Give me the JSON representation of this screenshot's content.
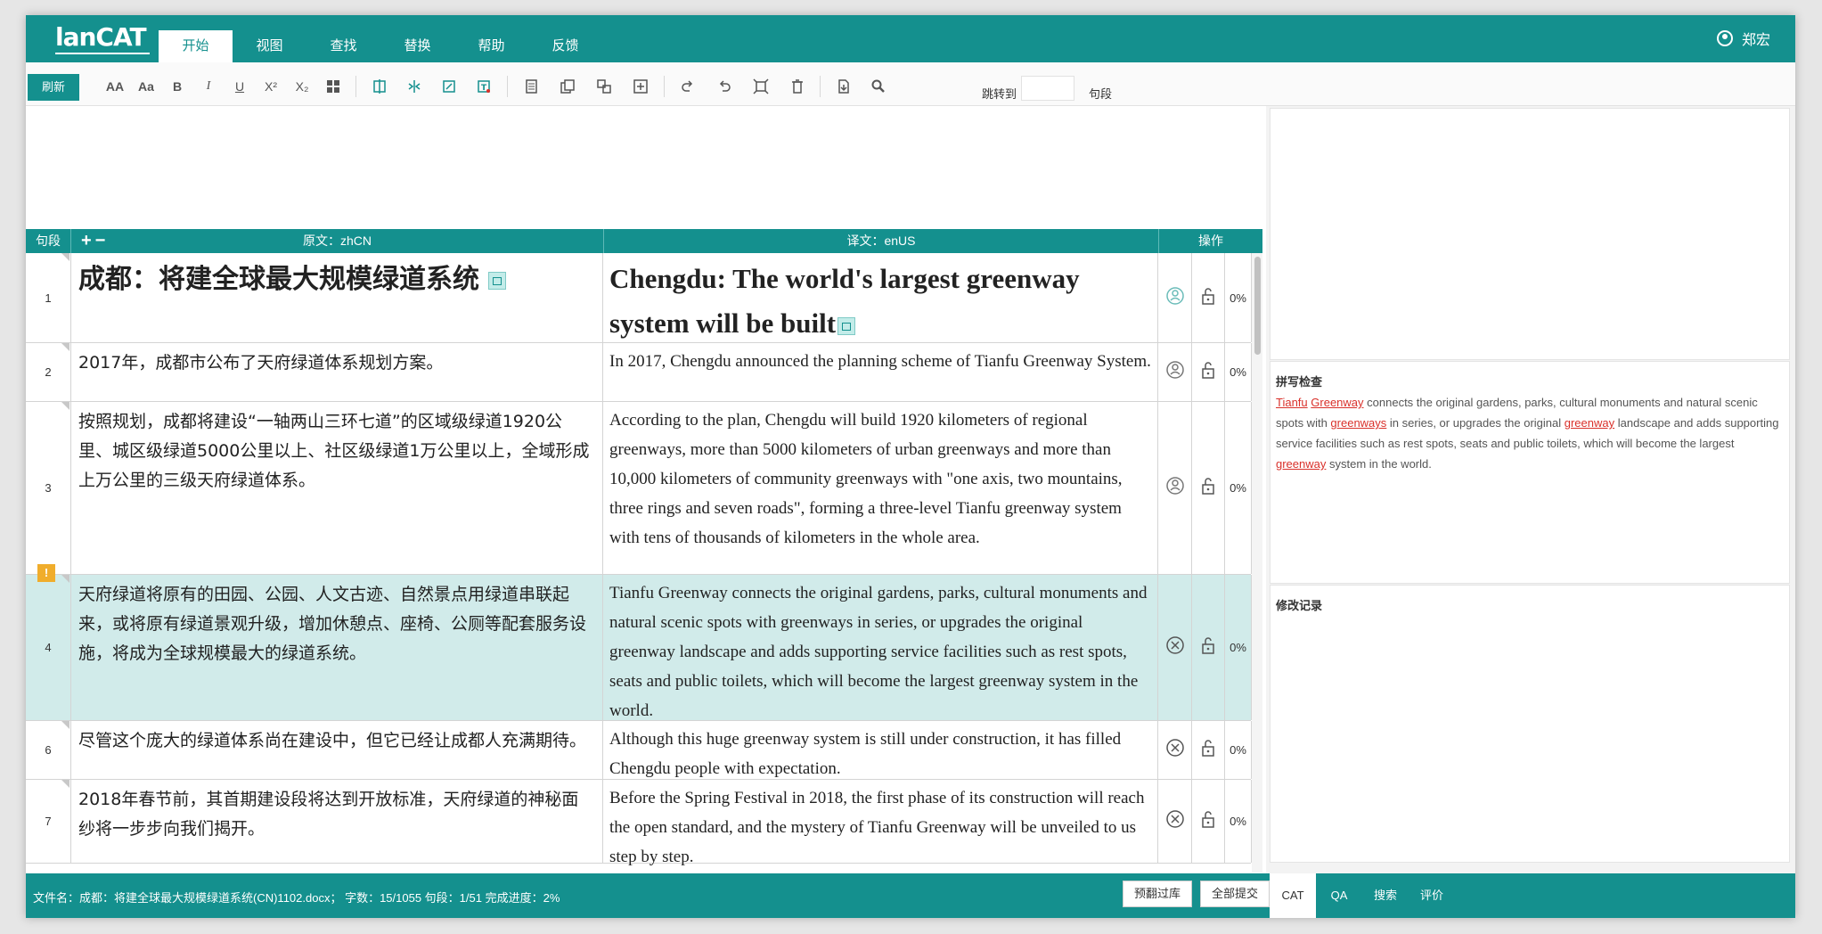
{
  "app": {
    "logo": "lanCAT",
    "tabs": [
      "开始",
      "视图",
      "查找",
      "替换",
      "帮助",
      "反馈"
    ],
    "active_tab": "开始",
    "user_name": "郑宏"
  },
  "toolbar": {
    "refresh_label": "刷新",
    "font_size_label": "AA",
    "case_label": "Aa",
    "bold_label": "B",
    "italic_label": "I",
    "underline_label": "U",
    "superscript_label": "X²",
    "subscript_label": "X₂",
    "jump_label": "跳转到",
    "jump_value": "",
    "jump_unit": "句段"
  },
  "grid": {
    "headers": {
      "segment": "句段",
      "plus_minus": "+−",
      "source": "原文：zhCN",
      "target": "译文：enUS",
      "actions": "操作"
    },
    "rows": [
      {
        "no": "1",
        "source": "成都：将建全球最大规模绿道系统",
        "target": "Chengdu: The world's largest greenway system will be built",
        "status": "0%",
        "confirm_icon": "pending-check-icon",
        "title_row": true
      },
      {
        "no": "2",
        "source": "2017年，成都市公布了天府绿道体系规划方案。",
        "target": "In 2017, Chengdu announced the planning scheme of Tianfu Greenway System.",
        "status": "0%",
        "confirm_icon": "pending-check-icon"
      },
      {
        "no": "3",
        "source": "按照规划，成都将建设“一轴两山三环七道”的区域级绿道1920公里、城区级绿道5000公里以上、社区级绿道1万公里以上，全域形成上万公里的三级天府绿道体系。",
        "target": "According to the plan, Chengdu will build 1920 kilometers of regional greenways, more than 5000 kilometers of urban greenways and more than 10,000 kilometers of community greenways with \"one axis, two mountains, three rings and seven roads\", forming a three-level Tianfu greenway system with tens of thousands of kilometers in the whole area.",
        "status": "0%",
        "confirm_icon": "pending-check-icon"
      },
      {
        "no": "4",
        "source": "天府绿道将原有的田园、公园、人文古迹、自然景点用绿道串联起来，或将原有绿道景观升级，增加休憩点、座椅、公厕等配套服务设施，将成为全球规模最大的绿道系统。",
        "target": "Tianfu Greenway connects the original gardens, parks, cultural monuments and natural scenic spots with greenways in series, or upgrades the original greenway landscape and adds supporting service facilities such as rest spots, seats and public toilets, which will become the largest greenway system in the world.",
        "status": "0%",
        "confirm_icon": "clear-icon",
        "warning": "!",
        "selected": true
      },
      {
        "no": "6",
        "source": "尽管这个庞大的绿道体系尚在建设中，但它已经让成都人充满期待。",
        "target": "Although this huge greenway system is still under construction, it has filled Chengdu people with expectation.",
        "status": "0%",
        "confirm_icon": "clear-icon"
      },
      {
        "no": "7",
        "source": "2018年春节前，其首期建设段将达到开放标准，天府绿道的神秘面纱将一步步向我们揭开。",
        "target": "Before the Spring Festival in 2018, the first phase of its construction will reach the open standard, and the mystery of Tianfu Greenway will be unveiled to us step by step.",
        "status": "0%",
        "confirm_icon": "clear-icon"
      }
    ]
  },
  "right_panel": {
    "spell_title": "拼写检查",
    "spell_parts": [
      {
        "t": "Tianfu",
        "err": true
      },
      {
        "t": " ",
        "err": false
      },
      {
        "t": "Greenway",
        "err": true
      },
      {
        "t": " connects the original gardens, parks, cultural monuments and natural scenic spots with ",
        "err": false
      },
      {
        "t": "greenways",
        "err": true
      },
      {
        "t": " in series, or upgrades the original ",
        "err": false
      },
      {
        "t": "greenway",
        "err": true
      },
      {
        "t": " landscape and adds supporting service facilities such as rest spots, seats and public toilets, which will become the largest ",
        "err": false
      },
      {
        "t": "greenway",
        "err": true
      },
      {
        "t": " system in the world.",
        "err": false
      }
    ],
    "history_title": "修改记录"
  },
  "statusbar": {
    "info": "文件名：成都：将建全球最大规模绿道系统(CN)1102.docx； 字数：15/1055  句段：1/51  完成进度：2%",
    "pretranslate_label": "预翻过库",
    "submit_all_label": "全部提交",
    "right_tabs": [
      "CAT",
      "QA",
      "搜索",
      "评价"
    ],
    "active_right_tab": "CAT"
  },
  "colors": {
    "brand": "#14908e",
    "selected_row": "#d1ebea",
    "spell_error": "#d9302a",
    "warning": "#f0ad2c"
  }
}
